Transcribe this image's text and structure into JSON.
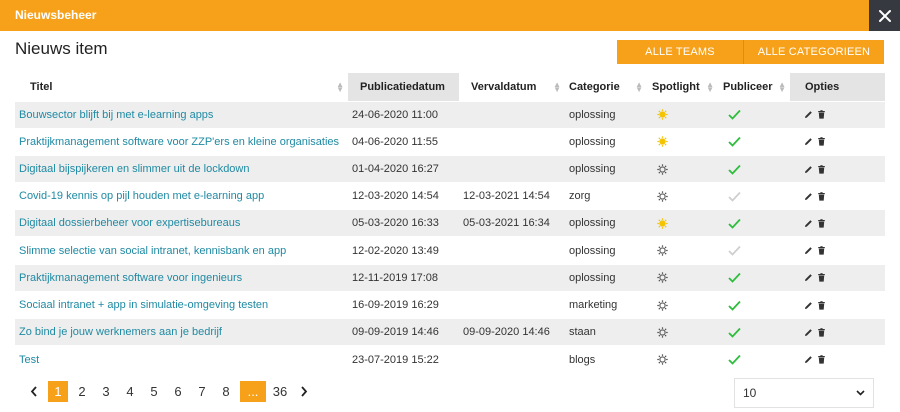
{
  "window": {
    "title": "Nieuwsbeheer"
  },
  "page": {
    "title": "Nieuws item"
  },
  "toolbar": {
    "teams_label": "ALLE TEAMS",
    "categories_label": "ALLE CATEGORIEEN"
  },
  "table": {
    "headers": {
      "titel": "Titel",
      "publicatiedatum": "Publicatiedatum",
      "vervaldatum": "Vervaldatum",
      "categorie": "Categorie",
      "spotlight": "Spotlight",
      "publiceer": "Publiceer",
      "opties": "Opties"
    },
    "rows": [
      {
        "titel": "Bouwsector blijft bij met e-learning apps",
        "publicatiedatum": "24-06-2020 11:00",
        "vervaldatum": "",
        "categorie": "oplossing",
        "spotlight": true,
        "published": true
      },
      {
        "titel": "Praktijkmanagement software voor ZZP'ers en kleine organisaties",
        "publicatiedatum": "04-06-2020 11:55",
        "vervaldatum": "",
        "categorie": "oplossing",
        "spotlight": true,
        "published": true
      },
      {
        "titel": "Digitaal bijspijkeren en slimmer uit de lockdown",
        "publicatiedatum": "01-04-2020 16:27",
        "vervaldatum": "",
        "categorie": "oplossing",
        "spotlight": false,
        "published": true
      },
      {
        "titel": "Covid-19 kennis op pijl houden met e-learning app",
        "publicatiedatum": "12-03-2020 14:54",
        "vervaldatum": "12-03-2021 14:54",
        "categorie": "zorg",
        "spotlight": false,
        "published": false
      },
      {
        "titel": "Digitaal dossierbeheer voor expertisebureaus",
        "publicatiedatum": "05-03-2020 16:33",
        "vervaldatum": "05-03-2021 16:34",
        "categorie": "oplossing",
        "spotlight": true,
        "published": true
      },
      {
        "titel": "Slimme selectie van social intranet, kennisbank en app",
        "publicatiedatum": "12-02-2020 13:49",
        "vervaldatum": "",
        "categorie": "oplossing",
        "spotlight": false,
        "published": false
      },
      {
        "titel": "Praktijkmanagement software voor ingenieurs",
        "publicatiedatum": "12-11-2019 17:08",
        "vervaldatum": "",
        "categorie": "oplossing",
        "spotlight": false,
        "published": true
      },
      {
        "titel": "Sociaal intranet + app in simulatie-omgeving testen",
        "publicatiedatum": "16-09-2019 16:29",
        "vervaldatum": "",
        "categorie": "marketing",
        "spotlight": false,
        "published": true
      },
      {
        "titel": "Zo bind je jouw werknemers aan je bedrijf",
        "publicatiedatum": "09-09-2019 14:46",
        "vervaldatum": "09-09-2020 14:46",
        "categorie": "staan",
        "spotlight": false,
        "published": true
      },
      {
        "titel": "Test",
        "publicatiedatum": "23-07-2019 15:22",
        "vervaldatum": "",
        "categorie": "blogs",
        "spotlight": false,
        "published": true
      }
    ]
  },
  "pagination": {
    "pages": [
      "1",
      "2",
      "3",
      "4",
      "5",
      "6",
      "7",
      "8"
    ],
    "active": "1",
    "ellipsis": "...",
    "last": "36"
  },
  "per_page": {
    "value": "10"
  },
  "colors": {
    "accent": "#f7a11a",
    "spotlight_on": "#f5c400",
    "spotlight_off": "#555555",
    "published": "#2ebd3c",
    "unpublished": "#cfcfcf",
    "link": "#1f8aa3",
    "close_bg": "#36393f"
  },
  "icons": {
    "close": "close-icon",
    "spotlight": "sun-icon",
    "published": "check-icon",
    "edit": "pencil-icon",
    "delete": "trash-icon",
    "prev": "chevron-left-icon",
    "next": "chevron-right-icon",
    "dropdown": "chevron-down-icon",
    "sort": "sort-icon"
  }
}
